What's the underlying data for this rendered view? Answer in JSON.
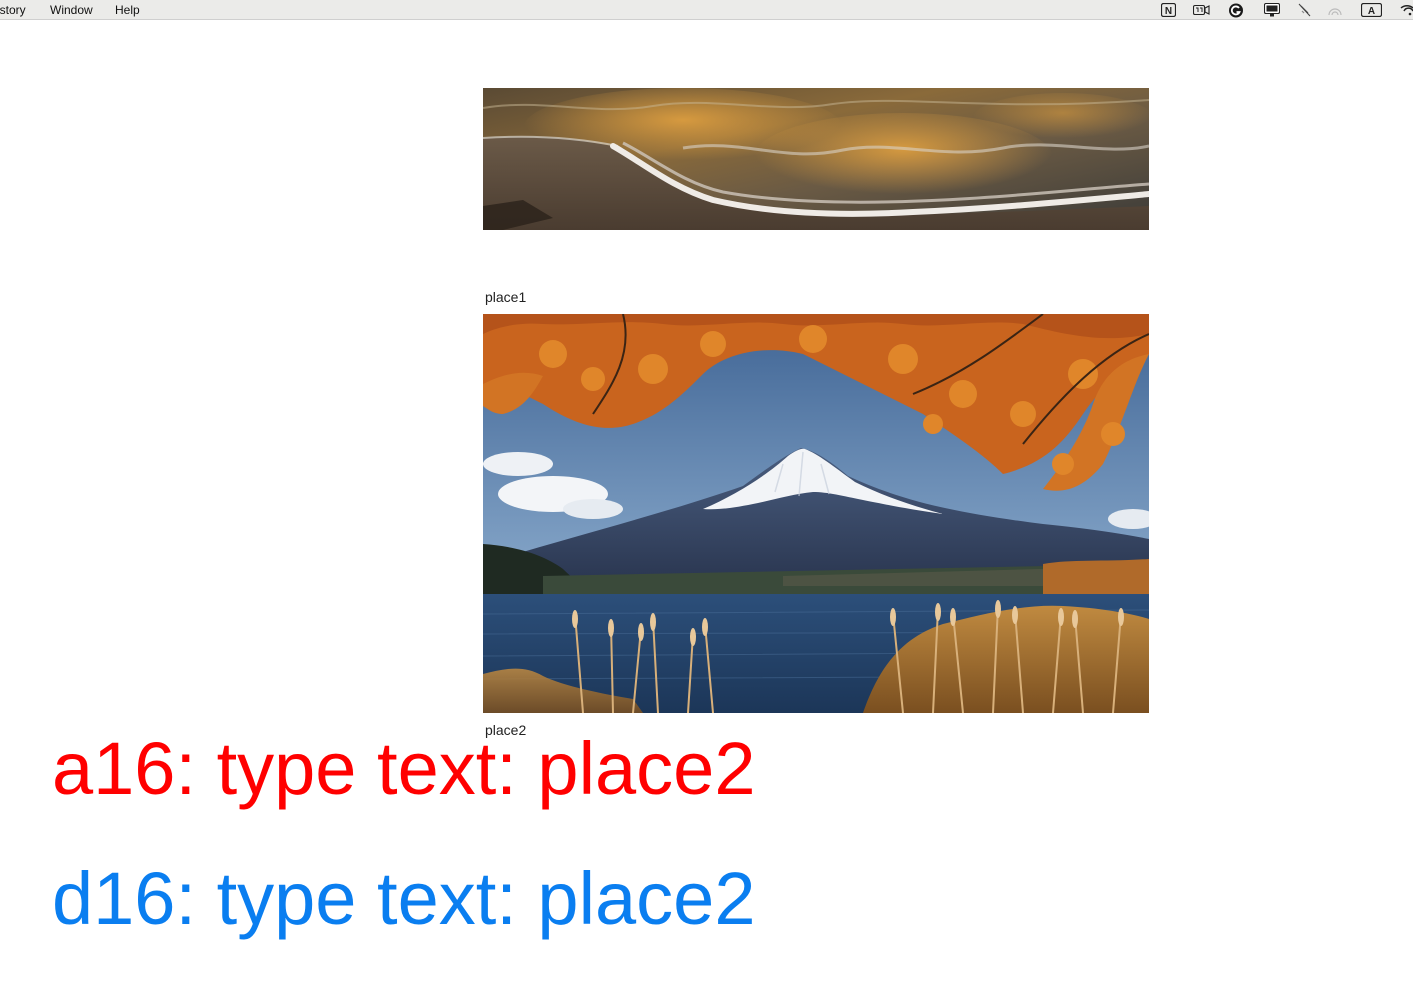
{
  "menubar": {
    "items": [
      "istory",
      "Window",
      "Help"
    ],
    "tray_icons": [
      "notion-icon",
      "screen-record-icon",
      "grammarly-icon",
      "display-icon",
      "mute-icon",
      "airdrop-icon",
      "input-source-icon",
      "wifi-icon"
    ],
    "input_source_label": "A",
    "notion_label": "N"
  },
  "images": [
    {
      "caption": "place1",
      "subject": "waves-on-beach-image"
    },
    {
      "caption": "place2",
      "subject": "mount-fuji-autumn-image"
    }
  ],
  "annotations": {
    "agent_a": "a16: type text: place2",
    "agent_d": "d16: type text: place2",
    "agent_a_color": "#ff0000",
    "agent_d_color": "#0a7ef0"
  }
}
